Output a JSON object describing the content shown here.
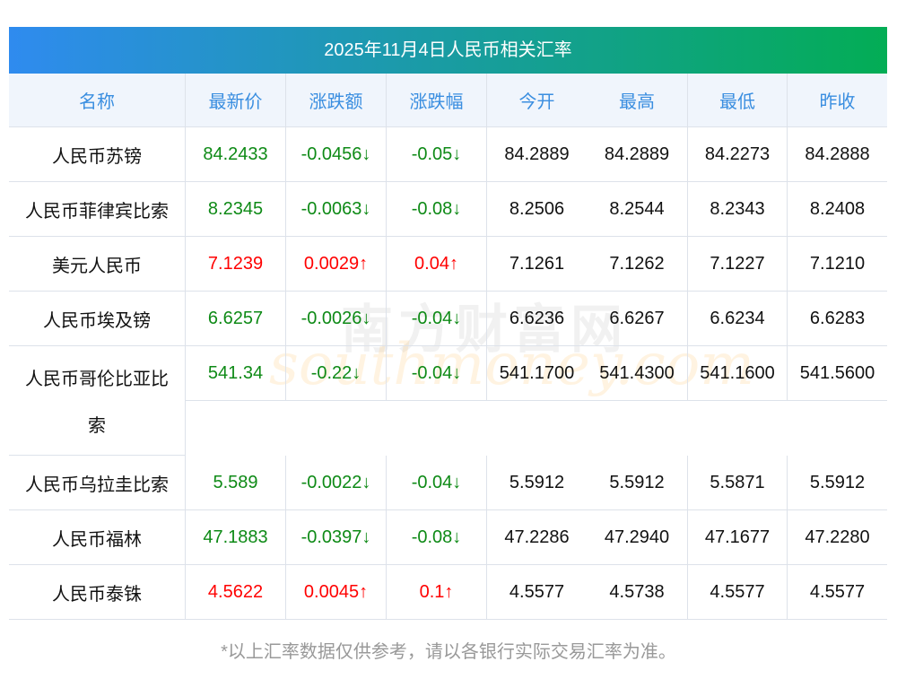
{
  "title": "2025年11月4日人民币相关汇率",
  "columns": [
    "名称",
    "最新价",
    "涨跌额",
    "涨跌幅",
    "今开",
    "最高",
    "最低",
    "昨收"
  ],
  "rows": [
    {
      "name": "人民币苏镑",
      "latest": "84.2433",
      "change": "-0.0456↓",
      "pct": "-0.05↓",
      "open": "84.2889",
      "high": "84.2889",
      "low": "84.2273",
      "prev": "84.2888",
      "dir": "down"
    },
    {
      "name": "人民币菲律宾比索",
      "latest": "8.2345",
      "change": "-0.0063↓",
      "pct": "-0.08↓",
      "open": "8.2506",
      "high": "8.2544",
      "low": "8.2343",
      "prev": "8.2408",
      "dir": "down"
    },
    {
      "name": "美元人民币",
      "latest": "7.1239",
      "change": "0.0029↑",
      "pct": "0.04↑",
      "open": "7.1261",
      "high": "7.1262",
      "low": "7.1227",
      "prev": "7.1210",
      "dir": "up"
    },
    {
      "name": "人民币埃及镑",
      "latest": "6.6257",
      "change": "-0.0026↓",
      "pct": "-0.04↓",
      "open": "6.6236",
      "high": "6.6267",
      "low": "6.6234",
      "prev": "6.6283",
      "dir": "down"
    },
    {
      "name": "人民币哥伦比亚比索",
      "latest": "541.34",
      "change": "-0.22↓",
      "pct": "-0.04↓",
      "open": "541.1700",
      "high": "541.4300",
      "low": "541.1600",
      "prev": "541.5600",
      "dir": "down",
      "wrap": true
    },
    {
      "name": "人民币乌拉圭比索",
      "latest": "5.589",
      "change": "-0.0022↓",
      "pct": "-0.04↓",
      "open": "5.5912",
      "high": "5.5912",
      "low": "5.5871",
      "prev": "5.5912",
      "dir": "down"
    },
    {
      "name": "人民币福林",
      "latest": "47.1883",
      "change": "-0.0397↓",
      "pct": "-0.08↓",
      "open": "47.2286",
      "high": "47.2940",
      "low": "47.1677",
      "prev": "47.2280",
      "dir": "down"
    },
    {
      "name": "人民币泰铢",
      "latest": "4.5622",
      "change": "0.0045↑",
      "pct": "0.1↑",
      "open": "4.5577",
      "high": "4.5738",
      "low": "4.5577",
      "prev": "4.5577",
      "dir": "up"
    }
  ],
  "watermark": {
    "cn": "南方财富网",
    "en": "southmoney.com"
  },
  "note": "*以上汇率数据仅供参考，请以各银行实际交易汇率为准。"
}
